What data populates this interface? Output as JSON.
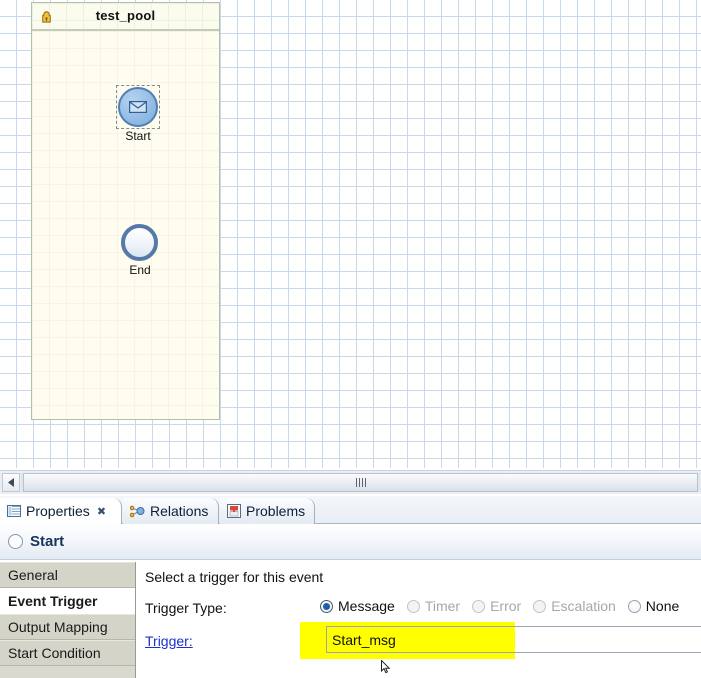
{
  "canvas": {
    "pool": {
      "name": "test_pool",
      "warning_icon": "warning-icon",
      "elements": [
        {
          "id": "start",
          "label": "Start",
          "type": "message-start-event",
          "icon": "envelope-icon",
          "selected": true
        },
        {
          "id": "end",
          "label": "End",
          "type": "end-event",
          "icon": "circle-icon",
          "selected": false
        }
      ]
    },
    "scrollbar": {
      "left_arrow_icon": "triangle-left-icon",
      "grip_icon": "grip-icon"
    }
  },
  "view_tabs": [
    {
      "id": "properties",
      "label": "Properties",
      "icon": "table-icon",
      "close_glyph": "✖",
      "active": true
    },
    {
      "id": "relations",
      "label": "Relations",
      "icon": "relations-graph-icon",
      "active": false
    },
    {
      "id": "problems",
      "label": "Problems",
      "icon": "problems-icon",
      "active": false
    }
  ],
  "properties": {
    "header": {
      "title": "Start",
      "icon": "circle-icon"
    },
    "tabs": [
      {
        "id": "general",
        "label": "General",
        "selected": false
      },
      {
        "id": "event-trigger",
        "label": "Event Trigger",
        "selected": true
      },
      {
        "id": "output-mapping",
        "label": "Output Mapping",
        "selected": false
      },
      {
        "id": "start-condition",
        "label": "Start Condition",
        "selected": false
      }
    ],
    "event_trigger": {
      "intro_text": "Select a trigger for this event",
      "trigger_type_label": "Trigger Type:",
      "trigger_options": [
        {
          "id": "message",
          "label": "Message",
          "checked": true,
          "disabled": false
        },
        {
          "id": "timer",
          "label": "Timer",
          "checked": false,
          "disabled": true
        },
        {
          "id": "error",
          "label": "Error",
          "checked": false,
          "disabled": true
        },
        {
          "id": "escalation",
          "label": "Escalation",
          "checked": false,
          "disabled": true
        },
        {
          "id": "none",
          "label": "None",
          "checked": false,
          "disabled": false
        }
      ],
      "trigger_link_label": "Trigger:",
      "trigger_value": "Start_msg",
      "trigger_placeholder": ""
    }
  },
  "colors": {
    "highlight": "#ffff00",
    "link": "#1a2fcd",
    "header_title": "#14355e",
    "event_stroke": "#4f7fb5",
    "pool_fill": "#fdfdf2",
    "grid_line": "#c9d9ec"
  }
}
